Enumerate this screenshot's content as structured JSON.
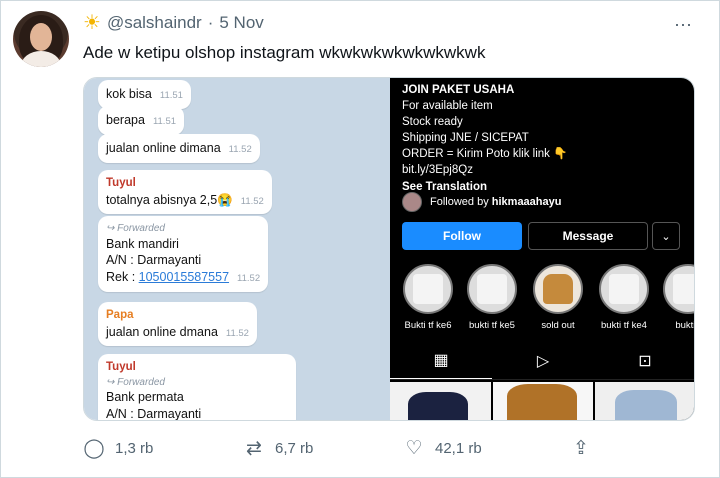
{
  "tweet": {
    "handle": "@salshaindr",
    "separator": "·",
    "date": "5 Nov",
    "text": "Ade w ketipu olshop instagram wkwkwkwkwkwkwkwk",
    "more_icon": "⋯"
  },
  "chat": {
    "messages": [
      {
        "text": "kok bisa",
        "time": "11.51"
      },
      {
        "text": "berapa",
        "time": "11.51"
      },
      {
        "text": "jualan online dimana",
        "time": "11.52"
      },
      {
        "sender": "Tuyul",
        "text": "totalnya abisnya 2,5😭",
        "time": "11.52"
      },
      {
        "forwarded": "Forwarded",
        "line1": "Bank mandiri",
        "line2": "A/N : Darmayanti",
        "line3_prefix": "Rek : ",
        "link": "1050015587557",
        "time": "11.52"
      },
      {
        "sender": "Papa",
        "text": "jualan online dmana",
        "time": "11.52"
      },
      {
        "sender": "Tuyul",
        "forwarded": "Forwarded",
        "line1": "Bank permata",
        "line2": "A/N : Darmayanti"
      }
    ],
    "forward_icon": "↪"
  },
  "instagram": {
    "bio_lines": [
      "JOIN PAKET USAHA",
      "For available item",
      "Stock ready",
      "Shipping JNE / SICEPAT",
      "ORDER = Kirim Poto klik link 👇",
      "bit.ly/3Epj8Qz"
    ],
    "see_translation": "See Translation",
    "followed_prefix": "Followed by ",
    "followed_by": "hikmaaahayu",
    "follow_label": "Follow",
    "message_label": "Message",
    "dropdown_icon": "⌄",
    "highlights": [
      "Bukti tf ke6",
      "bukti tf ke5",
      "sold out",
      "bukti tf ke4",
      "bukti t"
    ],
    "tab_icons": {
      "grid": "▦",
      "reels": "▷",
      "tagged": "⊡"
    }
  },
  "actions": {
    "reply_count": "1,3 rb",
    "retweet_count": "6,7 rb",
    "like_count": "42,1 rb",
    "reply_icon": "◯",
    "retweet_icon": "⇄",
    "like_icon": "♡",
    "share_icon": "⇪"
  }
}
